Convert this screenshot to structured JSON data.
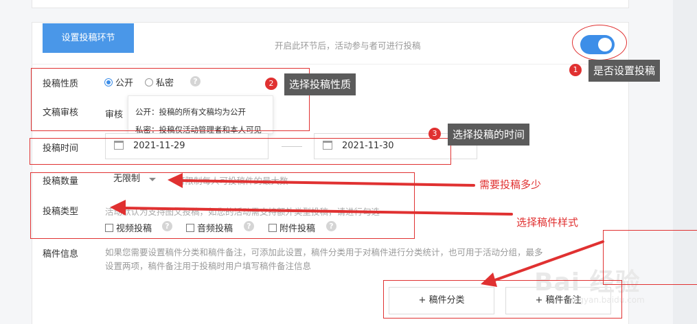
{
  "section": {
    "tag": "设置投稿环节",
    "hint": "开启此环节后，活动参与者可进行投稿",
    "toggle_on": true,
    "accent_color": "#3d8ee8"
  },
  "nature": {
    "label": "投稿性质",
    "option_public": "公开",
    "option_private": "私密",
    "selected": "公开"
  },
  "review": {
    "label": "文稿审核",
    "value_partial": "审核"
  },
  "tooltip": {
    "line1": "公开：投稿的所有文稿均为公开",
    "line2": "私密：投稿仅活动管理者和本人可见"
  },
  "time": {
    "label": "投稿时间",
    "start": "2021-11-29",
    "end": "2021-11-30"
  },
  "count": {
    "label": "投稿数量",
    "selected": "无限制",
    "hint": "可限制每人可投稿件的最大数"
  },
  "type": {
    "label": "投稿类型",
    "hint": "活动默认为支持图文投稿，如您的活动需支持额外类型投稿，请进行勾选",
    "options": [
      "视频投稿",
      "音频投稿",
      "附件投稿"
    ]
  },
  "info": {
    "label": "稿件信息",
    "line1": "如果您需要设置稿件分类和稿件备注，可添加此设置，稿件分类用于对稿件进行分类统计，也可用于活动分组，最多",
    "line2": "设置两项，稿件备注用于投稿时用户填写稿件备注信息",
    "btn_category": "+ 稿件分类",
    "btn_note": "+ 稿件备注"
  },
  "annotations": {
    "n1": "1",
    "l1": "是否设置投稿",
    "n2": "2",
    "l2": "选择投稿性质",
    "n3": "3",
    "l3": "选择投稿的时间",
    "t_count": "需要投稿多少",
    "t_type": "选择稿件样式",
    "color": "#e03131"
  },
  "watermark": {
    "brand": "Bai 经验",
    "url": "jingyan.baidu.com"
  }
}
